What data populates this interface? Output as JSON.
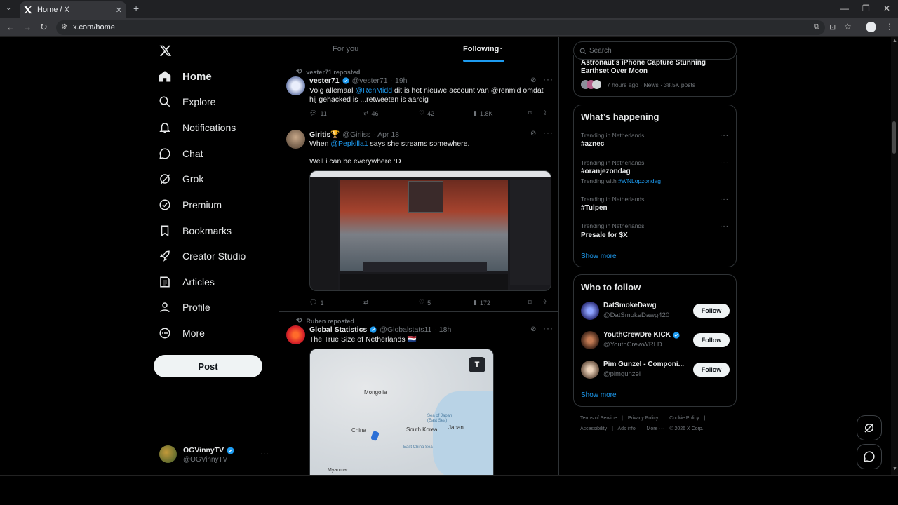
{
  "browser": {
    "tab_title": "Home / X",
    "url": "x.com/home"
  },
  "nav": {
    "items": [
      {
        "label": "Home",
        "icon": "home-icon"
      },
      {
        "label": "Explore",
        "icon": "search-icon"
      },
      {
        "label": "Notifications",
        "icon": "bell-icon"
      },
      {
        "label": "Chat",
        "icon": "chat-icon"
      },
      {
        "label": "Grok",
        "icon": "grok-icon"
      },
      {
        "label": "Premium",
        "icon": "premium-icon"
      },
      {
        "label": "Bookmarks",
        "icon": "bookmark-icon"
      },
      {
        "label": "Creator Studio",
        "icon": "rocket-icon"
      },
      {
        "label": "Articles",
        "icon": "articles-icon"
      },
      {
        "label": "Profile",
        "icon": "person-icon"
      },
      {
        "label": "More",
        "icon": "more-circle-icon"
      }
    ],
    "post_label": "Post",
    "account": {
      "name": "OGVinnyTV",
      "handle": "@OGVinnyTV"
    }
  },
  "feed": {
    "tabs": [
      "For you",
      "Following"
    ],
    "active_tab": "Following",
    "tweets": [
      {
        "repost": "vester71 reposted",
        "name": "vester71",
        "handle": "@vester71",
        "time": "· 19h",
        "text_pre": "Volg allemaal ",
        "mention": "@RenMidd",
        "text_post": " dit is het nieuwe account van @renmid omdat hij gehacked is ...retweeten is aardig",
        "stats": {
          "replies": "11",
          "reposts": "46",
          "likes": "42",
          "views": "1.8K"
        }
      },
      {
        "name": "Giritis🏆",
        "handle": "@Giriiss",
        "time": "· Apr 18",
        "text_pre": "When ",
        "mention": "@Pepkilla1",
        "text_post": " says she streams somewhere.",
        "text2": "Well i can be everywhere :D",
        "stats": {
          "replies": "1",
          "reposts": "",
          "likes": "5",
          "views": "172"
        }
      },
      {
        "repost": "Ruben reposted",
        "name": "Global Statistics",
        "handle": "@Globalstats11",
        "time": "· 18h",
        "text": "The True Size of Netherlands 🇳🇱",
        "map_labels": [
          "Mongolia",
          "China",
          "South Korea",
          "Japan",
          "Sea of Japan (East Sea)",
          "East China Sea",
          "Myanmar"
        ],
        "map_badge": "T"
      }
    ]
  },
  "right": {
    "search_placeholder": "Search",
    "news": {
      "title": "Astronaut's iPhone Capture Stunning Earthset Over Moon",
      "meta": "7 hours ago · News · 38.5K posts"
    },
    "happening_title": "What’s happening",
    "trends": [
      {
        "meta": "Trending in Netherlands",
        "name": "#aznec",
        "extra": ""
      },
      {
        "meta": "Trending in Netherlands",
        "name": "#oranjezondag",
        "extra_pre": "Trending with ",
        "extra_link": "#WNLopzondag"
      },
      {
        "meta": "Trending in Netherlands",
        "name": "#Tulpen",
        "extra": ""
      },
      {
        "meta": "Trending in Netherlands",
        "name": "Presale for $X",
        "extra": ""
      }
    ],
    "show_more": "Show more",
    "wtf_title": "Who to follow",
    "wtf": [
      {
        "name": "DatSmokeDawg",
        "handle": "@DatSmokeDawg420",
        "verified": false,
        "btn": "Follow"
      },
      {
        "name": "YouthCrewDre KICK",
        "handle": "@YouthCrewWRLD",
        "verified": true,
        "btn": "Follow"
      },
      {
        "name": "Pim Gunzel - Componi...",
        "handle": "@pimgunzel",
        "verified": false,
        "btn": "Follow"
      }
    ],
    "footer_line1": [
      "Terms of Service",
      "|",
      "Privacy Policy",
      "|",
      "Cookie Policy",
      "|"
    ],
    "footer_line2": [
      "Accessibility",
      "|",
      "Ads info",
      "|",
      "More ···",
      "© 2026 X Corp."
    ]
  },
  "colors": {
    "accent": "#1d9bf0",
    "background": "#000000",
    "text": "#e7e9ea",
    "muted": "#71767b",
    "border": "#2f3336"
  }
}
